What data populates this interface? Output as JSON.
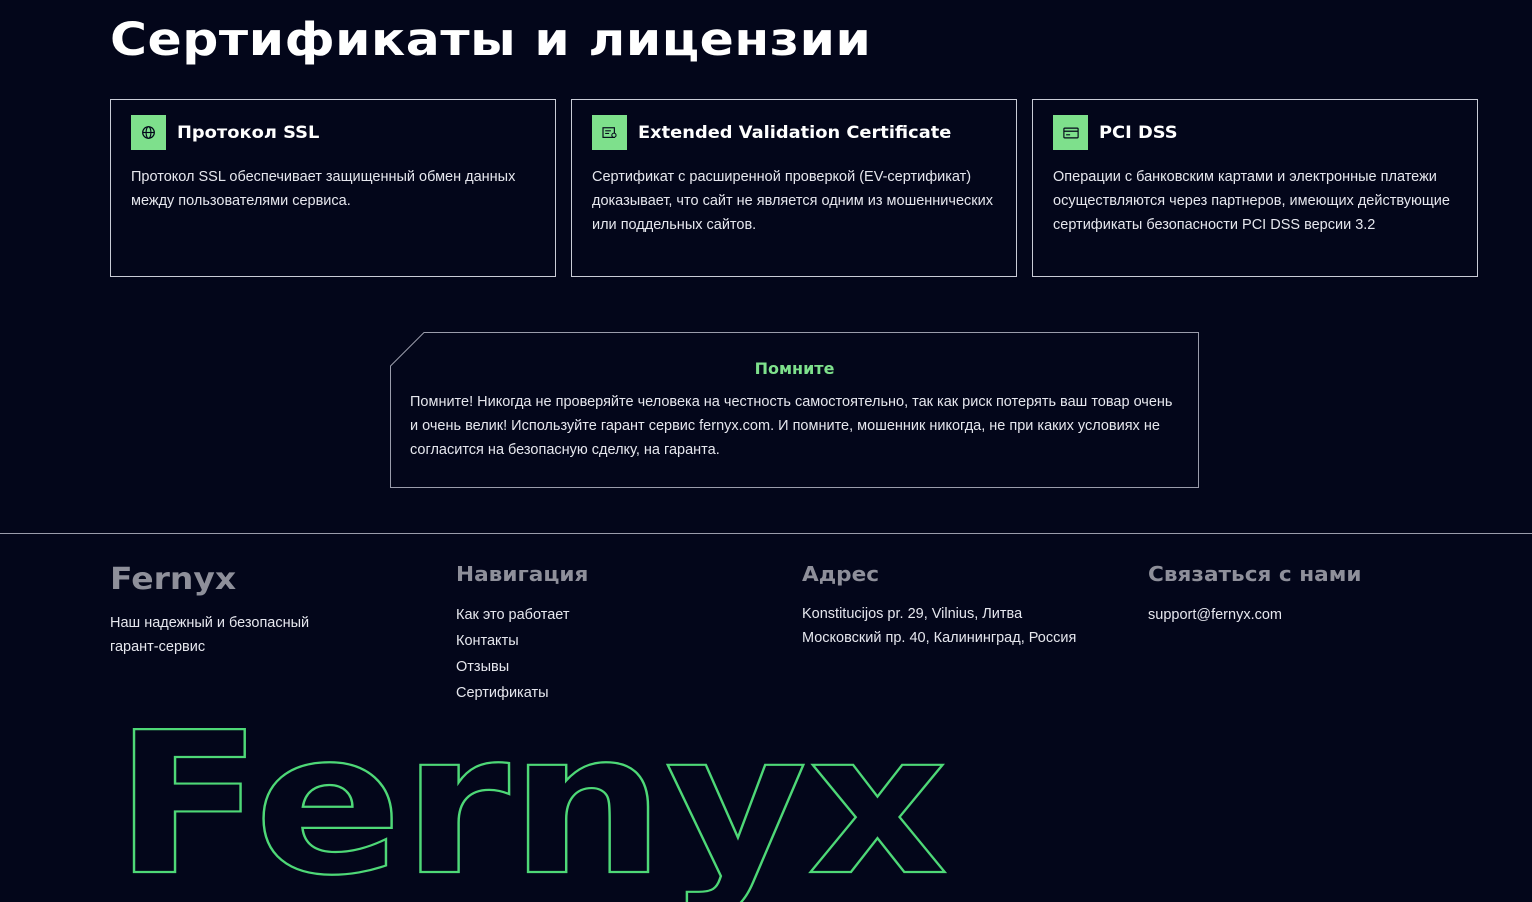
{
  "certificates": {
    "title": "Сертификаты и лицензии",
    "cards": [
      {
        "icon": "globe-icon",
        "title": "Протокол SSL",
        "text": "Протокол SSL обеспечивает защищенный обмен данных между пользователями сервиса."
      },
      {
        "icon": "certificate-icon",
        "title": "Extended Validation Certificate",
        "text": "Сертификат с расширенной проверкой (EV-сертификат) доказывает, что сайт не является одним из мошеннических или поддельных сайтов."
      },
      {
        "icon": "credit-card-icon",
        "title": "PCI DSS",
        "text": "Операции с банковским картами и электронные платежи осуществляются через партнеров, имеющих действующие сертификаты безопасности PCI DSS версии 3.2"
      }
    ]
  },
  "notice": {
    "title": "Помните",
    "text": "Помните! Никогда не проверяйте человека на честность самостоятельно, так как риск потерять ваш товар очень и очень велик! Используйте гарант сервис fernyx.com. И помните, мошенник никогда, не при каких условиях не согласится на безопасную сделку, на гаранта."
  },
  "footer": {
    "brand": "Fernyx",
    "tagline": "Наш надежный и безопасный гарант-сервис",
    "navigation": {
      "title": "Навигация",
      "links": [
        "Как это работает",
        "Контакты",
        "Отзывы",
        "Сертификаты"
      ]
    },
    "address": {
      "title": "Адрес",
      "lines": [
        "Konstitucijos pr. 29, Vilnius, Литва",
        "Московский пр. 40, Калининград, Россия"
      ]
    },
    "contact": {
      "title": "Связаться с нами",
      "email": "support@fernyx.com"
    },
    "big_logo": "Fernyx"
  },
  "colors": {
    "background": "#03061a",
    "accent": "#7ee08c",
    "muted_heading": "#8e8f9a"
  }
}
